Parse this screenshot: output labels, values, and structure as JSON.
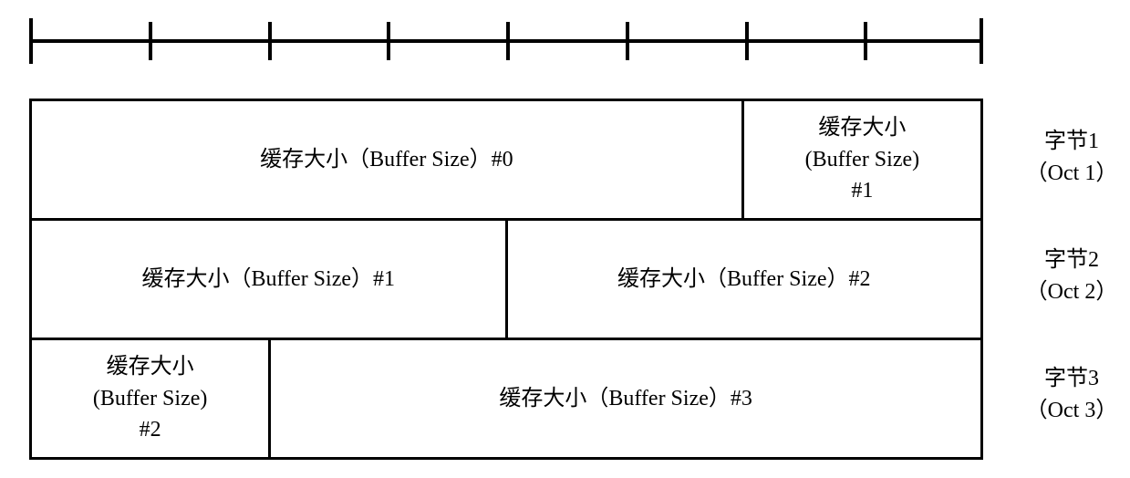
{
  "ruler": {
    "bits": 8
  },
  "rows": [
    {
      "cells": [
        {
          "label": "缓存大小（Buffer Size）#0",
          "bits": 6
        },
        {
          "label_top": "缓存大小",
          "label_mid": "(Buffer Size)",
          "label_bot": "#1",
          "bits": 2
        }
      ],
      "rowlabel_top": "字节1",
      "rowlabel_bot": "（Oct 1）"
    },
    {
      "cells": [
        {
          "label": "缓存大小（Buffer Size）#1",
          "bits": 4
        },
        {
          "label": "缓存大小（Buffer Size）#2",
          "bits": 4
        }
      ],
      "rowlabel_top": "字节2",
      "rowlabel_bot": "（Oct 2）"
    },
    {
      "cells": [
        {
          "label_top": "缓存大小",
          "label_mid": "(Buffer Size)",
          "label_bot": "#2",
          "bits": 2
        },
        {
          "label": "缓存大小（Buffer Size）#3",
          "bits": 6
        }
      ],
      "rowlabel_top": "字节3",
      "rowlabel_bot": "（Oct 3）"
    }
  ],
  "chart_data": {
    "type": "table",
    "description": "Bit-field layout across octets. 8 bits per row; each field labeled with index.",
    "bits_per_row": 8,
    "fields": [
      {
        "name": "Buffer Size #0",
        "bits": 6,
        "octet_start": 1
      },
      {
        "name": "Buffer Size #1",
        "bits": 6,
        "octet_start": 1
      },
      {
        "name": "Buffer Size #2",
        "bits": 6,
        "octet_start": 2
      },
      {
        "name": "Buffer Size #3",
        "bits": 6,
        "octet_start": 3
      }
    ],
    "octet_labels": [
      "字节1 (Oct 1)",
      "字节2 (Oct 2)",
      "字节3 (Oct 3)"
    ]
  }
}
